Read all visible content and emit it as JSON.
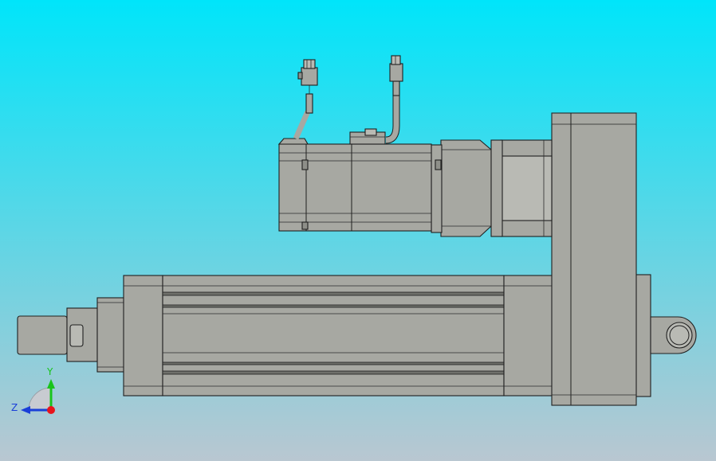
{
  "viewport": {
    "background_top": "#00e5fa",
    "background_bottom": "#b9c7d1",
    "part_color": "#a7a8a2",
    "edge_color": "#1f1f1f"
  },
  "triad": {
    "y_label": "Y",
    "z_label": "Z",
    "y_color": "#18c41b",
    "z_color": "#1a3fd8",
    "origin_color": "#e8141c"
  }
}
